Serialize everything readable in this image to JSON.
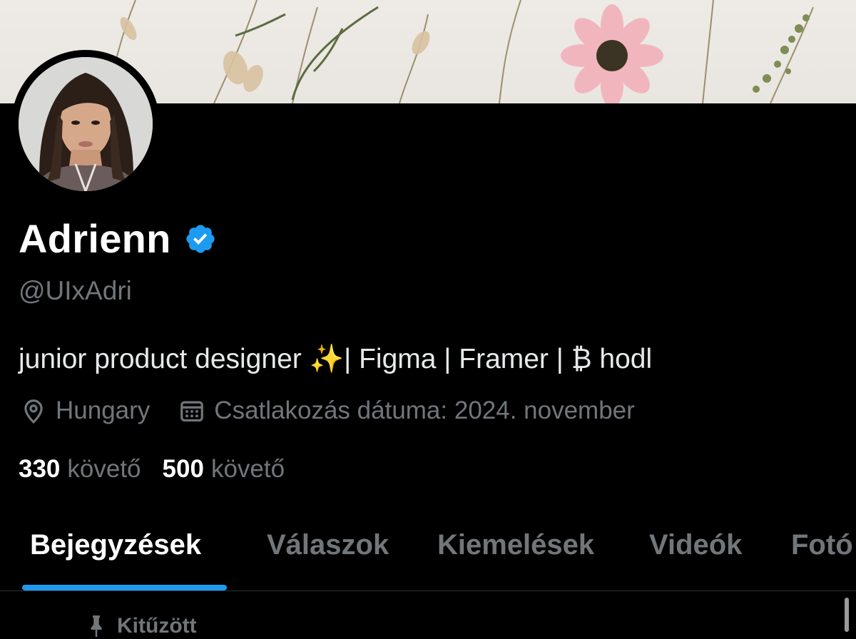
{
  "profile": {
    "name": "Adrienn",
    "handle": "@UIxAdri",
    "bio": "junior product designer ✨| Figma | Framer | ₿ hodl",
    "location": "Hungary",
    "joined": "Csatlakozás dátuma: 2024. november",
    "stats": [
      {
        "value": "330",
        "label": "követő"
      },
      {
        "value": "500",
        "label": "követő"
      }
    ]
  },
  "tabs": [
    {
      "label": "Bejegyzések",
      "active": true
    },
    {
      "label": "Válaszok",
      "active": false
    },
    {
      "label": "Kiemelések",
      "active": false
    },
    {
      "label": "Videók",
      "active": false
    },
    {
      "label": "Fotó",
      "active": false
    }
  ],
  "pinned": {
    "label": "Kitűzött"
  },
  "icons": {
    "verified": "verified-badge-icon",
    "location": "location-pin-icon",
    "calendar": "calendar-icon",
    "pin": "pin-icon"
  },
  "colors": {
    "background": "#000000",
    "text_primary": "#ffffff",
    "text_secondary": "#71767b",
    "accent": "#1d9bf0"
  }
}
